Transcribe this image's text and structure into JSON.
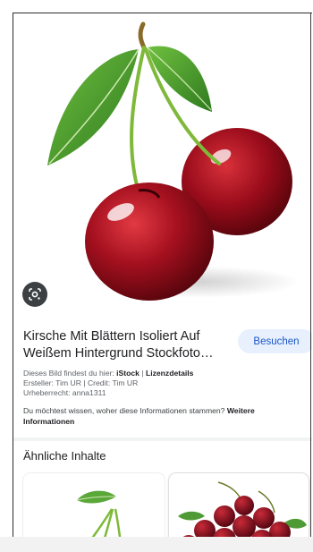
{
  "image": {
    "subject": "cherry-image",
    "lens_icon": "lens-icon"
  },
  "result": {
    "title": "Kirsche Mit Blättern Isoliert Auf Weißem Hintergrund Stockfoto…",
    "visit_button": "Besuchen",
    "found_at_prefix": "Dieses Bild findest du hier: ",
    "found_at_source": "iStock",
    "separator": " | ",
    "license_link": "Lizenzdetails",
    "creator_line": "Ersteller: Tim UR | Credit: Tim UR",
    "copyright_line": "Urheberrecht: anna1311",
    "question": "Du möchtest wissen, woher diese Informationen stammen? ",
    "more_info": "Weitere Informationen"
  },
  "similar": {
    "heading": "Ähnliche Inhalte"
  },
  "colors": {
    "accent_bg": "#e8f0fe",
    "accent_text": "#1a56c4",
    "cherry": "#a5101f",
    "leaf": "#4a9a2e"
  }
}
